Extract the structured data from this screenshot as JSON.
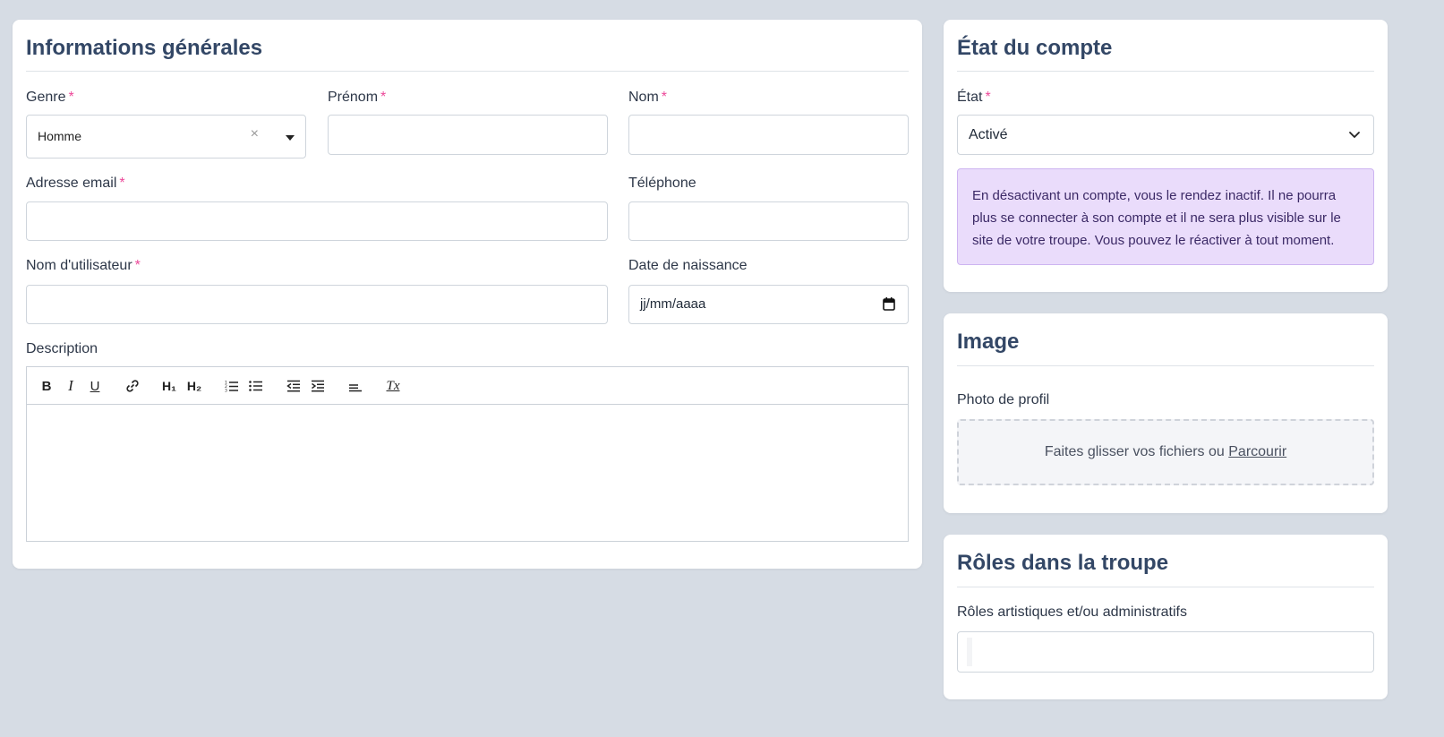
{
  "general": {
    "title": "Informations générales",
    "genre": {
      "label": "Genre",
      "required": "*",
      "value": "Homme",
      "clear": "×"
    },
    "prenom": {
      "label": "Prénom",
      "required": "*",
      "value": ""
    },
    "nom": {
      "label": "Nom",
      "required": "*",
      "value": ""
    },
    "email": {
      "label": "Adresse email",
      "required": "*",
      "value": ""
    },
    "telephone": {
      "label": "Téléphone",
      "value": ""
    },
    "username": {
      "label": "Nom d'utilisateur",
      "required": "*",
      "value": ""
    },
    "birthdate": {
      "label": "Date de naissance",
      "placeholder": "jj/mm/aaaa"
    },
    "description": {
      "label": "Description",
      "toolbar": {
        "bold": "B",
        "italic": "I",
        "underline": "U",
        "h1": "H₁",
        "h2": "H₂",
        "clear": "Tx"
      }
    }
  },
  "account": {
    "title": "État du compte",
    "state": {
      "label": "État",
      "required": "*",
      "value": "Activé"
    },
    "notice": "En désactivant un compte, vous le rendez inactif. Il ne pourra plus se connecter à son compte et il ne sera plus visible sur le site de votre troupe. Vous pouvez le réactiver à tout moment."
  },
  "image": {
    "title": "Image",
    "photo_label": "Photo de profil",
    "dropzone_text": "Faites glisser vos fichiers ou",
    "dropzone_link": "Parcourir"
  },
  "roles": {
    "title": "Rôles dans la troupe",
    "label": "Rôles artistiques et/ou administratifs"
  },
  "colors": {
    "background": "#d6dce4",
    "title": "#334766",
    "required": "#ec4899",
    "notice_bg": "#eadcfb"
  }
}
